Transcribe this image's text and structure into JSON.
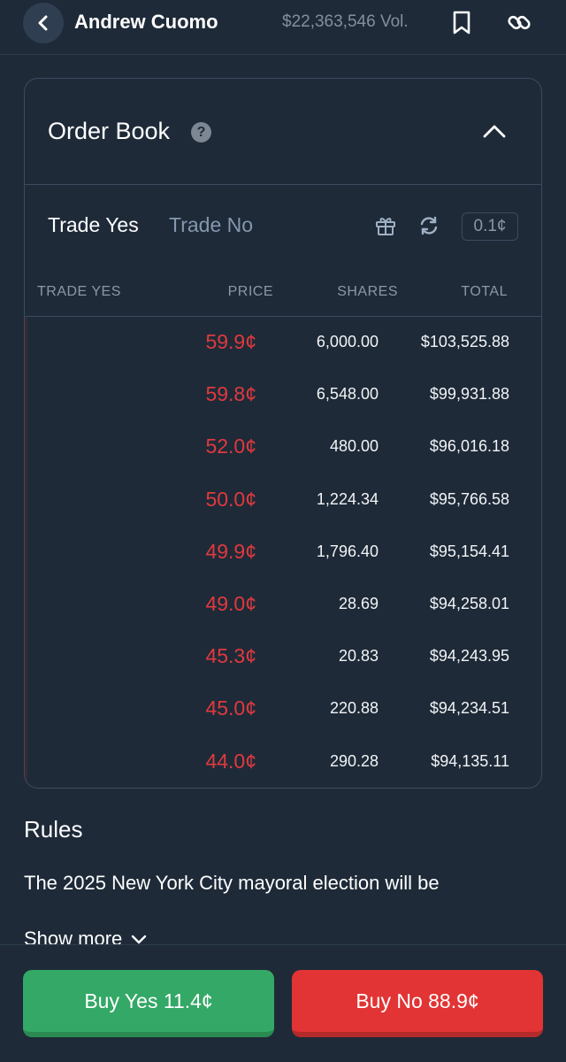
{
  "header": {
    "title": "Andrew Cuomo",
    "volume": "$22,363,546 Vol."
  },
  "order_book": {
    "title": "Order Book",
    "help_glyph": "?",
    "tabs": {
      "yes": "Trade Yes",
      "no": "Trade No"
    },
    "tick_size": "0.1¢",
    "columns": {
      "trade": "TRADE YES",
      "price": "PRICE",
      "shares": "SHARES",
      "total": "TOTAL"
    },
    "rows": [
      {
        "price": "59.9¢",
        "shares": "6,000.00",
        "total": "$103,525.88"
      },
      {
        "price": "59.8¢",
        "shares": "6,548.00",
        "total": "$99,931.88"
      },
      {
        "price": "52.0¢",
        "shares": "480.00",
        "total": "$96,016.18"
      },
      {
        "price": "50.0¢",
        "shares": "1,224.34",
        "total": "$95,766.58"
      },
      {
        "price": "49.9¢",
        "shares": "1,796.40",
        "total": "$95,154.41"
      },
      {
        "price": "49.0¢",
        "shares": "28.69",
        "total": "$94,258.01"
      },
      {
        "price": "45.3¢",
        "shares": "20.83",
        "total": "$94,243.95"
      },
      {
        "price": "45.0¢",
        "shares": "220.88",
        "total": "$94,234.51"
      },
      {
        "price": "44.0¢",
        "shares": "290.28",
        "total": "$94,135.11"
      }
    ]
  },
  "rules": {
    "title": "Rules",
    "text": "The 2025 New York City mayoral election will be",
    "show_more": "Show more"
  },
  "actions": {
    "buy_yes": "Buy Yes 11.4¢",
    "buy_no": "Buy No 88.9¢"
  },
  "colors": {
    "background": "#1e2a38",
    "ask_red": "#e0393e",
    "buy_yes_green": "#34a866",
    "buy_no_red": "#e23434"
  },
  "icons": [
    "back-icon",
    "bookmark-icon",
    "link-icon",
    "help-icon",
    "chevron-up-icon",
    "gift-icon",
    "refresh-icon",
    "chevron-down-icon"
  ]
}
